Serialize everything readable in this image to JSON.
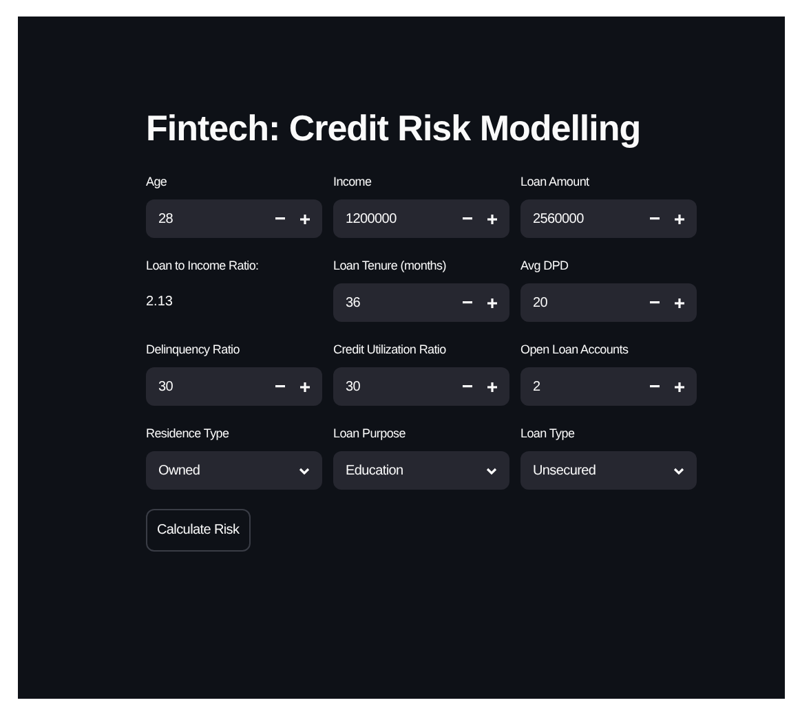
{
  "title": "Fintech: Credit Risk Modelling",
  "fields": [
    {
      "kind": "number",
      "label": "Age",
      "value": "28"
    },
    {
      "kind": "number",
      "label": "Income",
      "value": "1200000"
    },
    {
      "kind": "number",
      "label": "Loan Amount",
      "value": "2560000"
    },
    {
      "kind": "text",
      "label": "Loan to Income Ratio:",
      "value": "2.13"
    },
    {
      "kind": "number",
      "label": "Loan Tenure (months)",
      "value": "36"
    },
    {
      "kind": "number",
      "label": "Avg DPD",
      "value": "20"
    },
    {
      "kind": "number",
      "label": "Delinquency Ratio",
      "value": "30"
    },
    {
      "kind": "number",
      "label": "Credit Utilization Ratio",
      "value": "30"
    },
    {
      "kind": "number",
      "label": "Open Loan Accounts",
      "value": "2"
    },
    {
      "kind": "select",
      "label": "Residence Type",
      "value": "Owned"
    },
    {
      "kind": "select",
      "label": "Loan Purpose",
      "value": "Education"
    },
    {
      "kind": "select",
      "label": "Loan Type",
      "value": "Unsecured"
    }
  ],
  "button": "Calculate Risk"
}
